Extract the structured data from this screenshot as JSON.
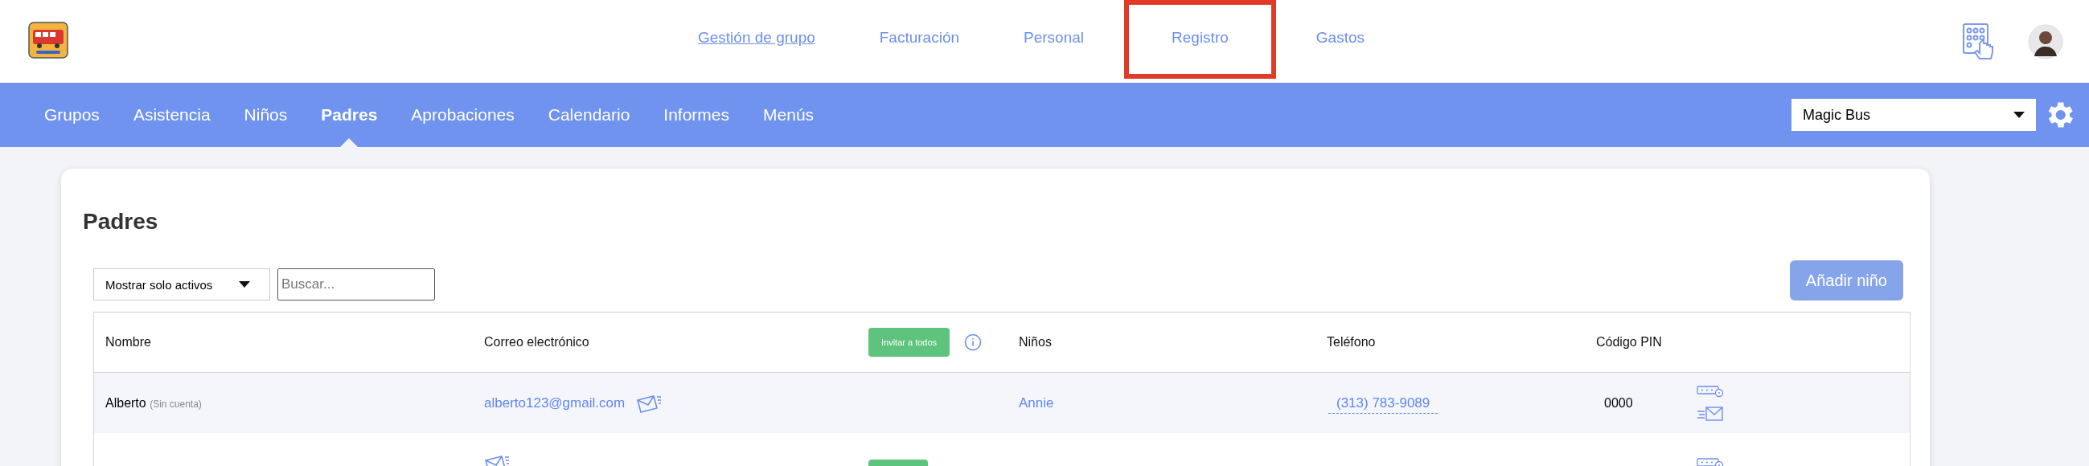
{
  "top_nav": [
    {
      "label": "Gestión de grupo",
      "selected": true,
      "highlighted": false
    },
    {
      "label": "Facturación",
      "selected": false,
      "highlighted": false
    },
    {
      "label": "Personal",
      "selected": false,
      "highlighted": false
    },
    {
      "label": "Registro",
      "selected": false,
      "highlighted": true
    },
    {
      "label": "Gastos",
      "selected": false,
      "highlighted": false
    }
  ],
  "sub_nav": [
    {
      "label": "Grupos",
      "selected": false
    },
    {
      "label": "Asistencia",
      "selected": false
    },
    {
      "label": "Niños",
      "selected": false
    },
    {
      "label": "Padres",
      "selected": true
    },
    {
      "label": "Aprobaciones",
      "selected": false
    },
    {
      "label": "Calendario",
      "selected": false
    },
    {
      "label": "Informes",
      "selected": false
    },
    {
      "label": "Menús",
      "selected": false
    }
  ],
  "center_select": {
    "value": "Magic Bus"
  },
  "page": {
    "title": "Padres",
    "filter": {
      "value": "Mostrar solo activos"
    },
    "search": {
      "placeholder": "Buscar..."
    },
    "add_button": "Añadir niño"
  },
  "table": {
    "columns": [
      "Nombre",
      "Correo electrónico",
      "Niños",
      "Teléfono",
      "Código PIN"
    ],
    "invite_all_button": "Invitar a todos",
    "rows": [
      {
        "name": "Alberto",
        "account_note": "(Sin cuenta)",
        "email": "alberto123@gmail.com",
        "invite_button": false,
        "children": "Annie",
        "phone": "(313) 783-9089",
        "pin": "0000"
      },
      {
        "invite_button": true
      }
    ]
  }
}
